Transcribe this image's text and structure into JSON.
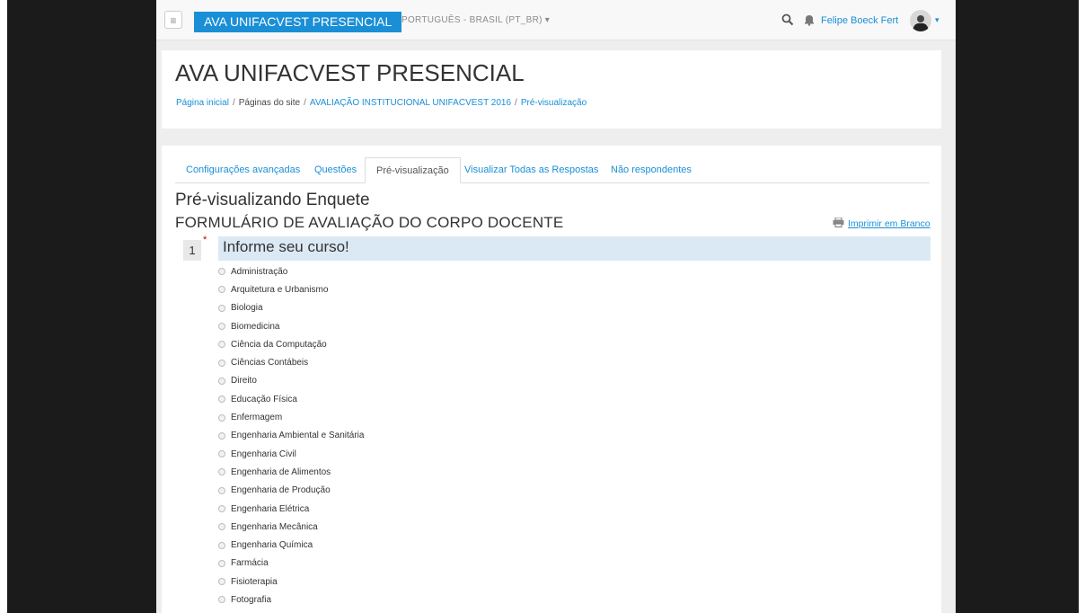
{
  "navbar": {
    "menu_icon": "hamburger-icon",
    "brand": "AVA UNIFACVEST PRESENCIAL",
    "language": "PORTUGUÊS - BRASIL (PT_BR) ▾",
    "username": "Felipe Boeck Fert",
    "user_menu_caret": "▾",
    "brand_color": "#1a8fd6"
  },
  "header": {
    "title": "AVA UNIFACVEST PRESENCIAL",
    "breadcrumb": [
      {
        "label": "Página inicial"
      },
      {
        "label": "Páginas do site"
      },
      {
        "label": "AVALIAÇÃO INSTITUCIONAL UNIFACVEST 2016"
      },
      {
        "label": "Pré-visualização"
      }
    ],
    "breadcrumb_separator": "/"
  },
  "tabs": [
    {
      "label": "Configurações avançadas"
    },
    {
      "label": "Questões"
    },
    {
      "label": "Pré-visualização",
      "active": true
    },
    {
      "label": "Visualizar Todas as Respostas"
    },
    {
      "label": "Não respondentes"
    }
  ],
  "survey": {
    "preview_heading": "Pré-visualizando Enquete",
    "form_title": "FORMULÁRIO DE AVALIAÇÃO DO CORPO DOCENTE",
    "print_label": "Imprimir em Branco",
    "question": {
      "number": "1",
      "required_mark": "*",
      "text": "Informe seu curso!",
      "options": [
        "Administração",
        "Arquitetura e Urbanismo",
        "Biologia",
        "Biomedicina",
        "Ciência da Computação",
        "Ciências Contábeis",
        "Direito",
        "Educação Física",
        "Enfermagem",
        "Engenharia Ambiental e Sanitária",
        "Engenharia Civil",
        "Engenharia de Alimentos",
        "Engenharia de Produção",
        "Engenharia Elétrica",
        "Engenharia Mecânica",
        "Engenharia Química",
        "Farmácia",
        "Fisioterapia",
        "Fotografia"
      ]
    }
  }
}
